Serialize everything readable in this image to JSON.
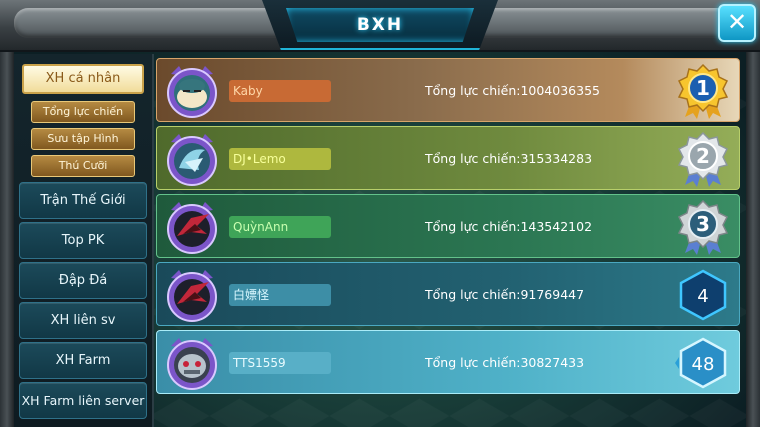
{
  "header": {
    "title": "BXH",
    "close_label": "✕"
  },
  "sidebar": {
    "active_tab": "XH cá nhân",
    "subtabs": [
      "Tổng lực chiến",
      "Sưu tập Hình",
      "Thú Cưỡi"
    ],
    "nav": [
      "Trận Thế Giới",
      "Top PK",
      "Đập Đá",
      "XH liên sv",
      "XH Farm",
      "XH Farm liên server"
    ]
  },
  "ranking": {
    "power_label": "Tổng lực chiến:",
    "rows": [
      {
        "rank": "1",
        "name": "Kaby",
        "power": "1004036355",
        "medal": "gold",
        "avatar_icon": "snorlax-icon"
      },
      {
        "rank": "2",
        "name": "DJ•Lemo",
        "power": "315334283",
        "medal": "silver",
        "avatar_icon": "blue-bird-icon"
      },
      {
        "rank": "3",
        "name": "QuỳnAnn",
        "power": "143542102",
        "medal": "bronze",
        "avatar_icon": "red-dragon-icon"
      },
      {
        "rank": "4",
        "name": "白嫖怪",
        "power": "91769447",
        "medal": "hexagon",
        "avatar_icon": "red-dragon-icon"
      },
      {
        "rank": "48",
        "name": "TTS1559",
        "power": "30827433",
        "medal": "hexagon",
        "avatar_icon": "steel-beast-icon"
      }
    ]
  }
}
